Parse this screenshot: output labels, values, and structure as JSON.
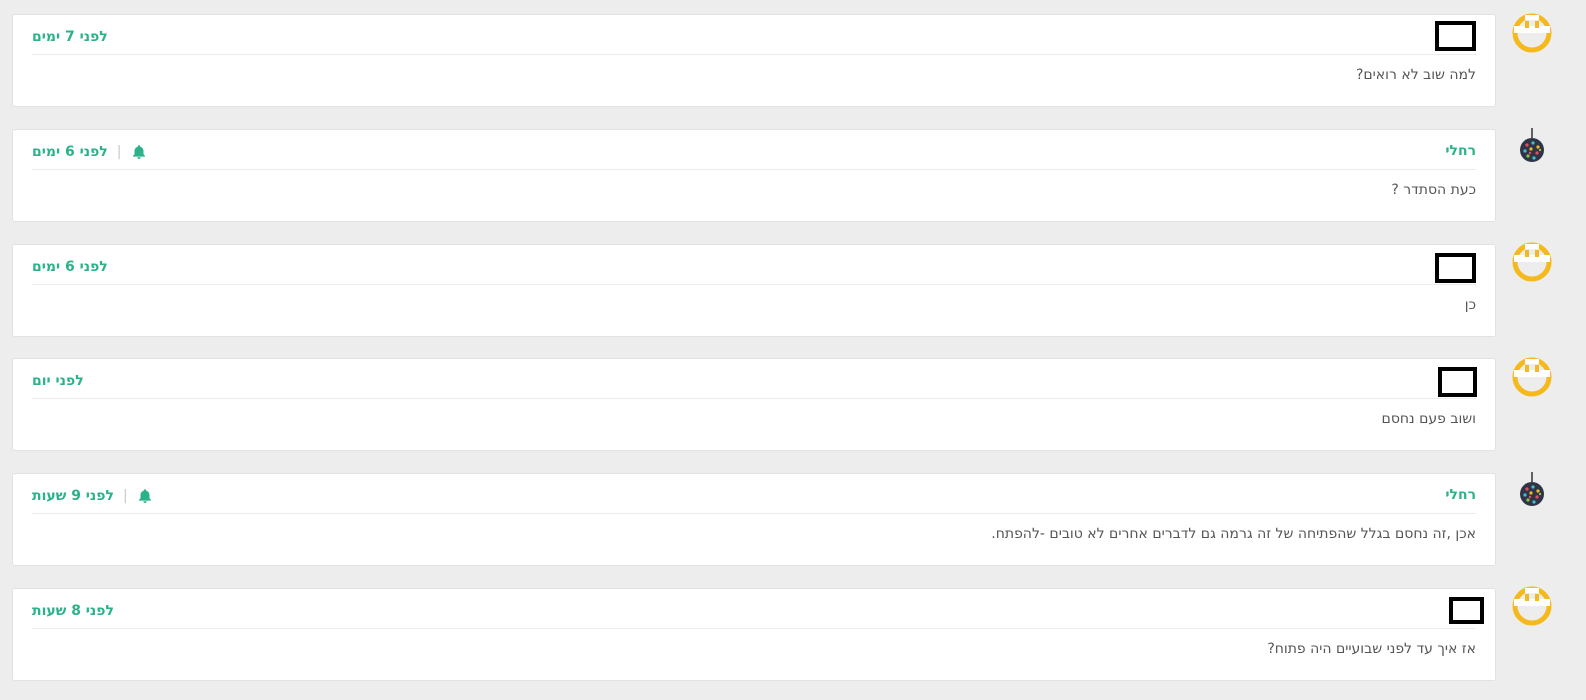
{
  "thread": {
    "posts": [
      {
        "author": "",
        "author_redacted": true,
        "avatar": "smiley-face-icon",
        "time": "לפני 7 ימים",
        "has_bell": false,
        "text": "למה שוב לא רואים?"
      },
      {
        "author": "רחלי",
        "author_redacted": false,
        "avatar": "disco-ball-icon",
        "time": "לפני 6 ימים",
        "has_bell": true,
        "text": "כעת הסתדר ?"
      },
      {
        "author": "",
        "author_redacted": true,
        "avatar": "smiley-face-icon",
        "time": "לפני 6 ימים",
        "has_bell": false,
        "text": "כן"
      },
      {
        "author": "",
        "author_redacted": true,
        "avatar": "smiley-face-icon",
        "time": "לפני יום",
        "has_bell": false,
        "text": "ושוב פעם נחסם"
      },
      {
        "author": "רחלי",
        "author_redacted": false,
        "avatar": "disco-ball-icon",
        "time": "לפני 9 שעות",
        "has_bell": true,
        "text": "אכן ,זה נחסם בגלל שהפתיחה של זה גרמה גם לדברים אחרים לא טובים -להפתח."
      },
      {
        "author": "",
        "author_redacted": true,
        "avatar": "smiley-face-icon",
        "time": "לפני 8 שעות",
        "has_bell": false,
        "text": "אז איך עד לפני שבועיים היה פתוח?"
      }
    ]
  },
  "colors": {
    "accent": "#2bb28a",
    "body_text": "#555555",
    "background": "#ededed",
    "smiley": "#f5b91e"
  }
}
